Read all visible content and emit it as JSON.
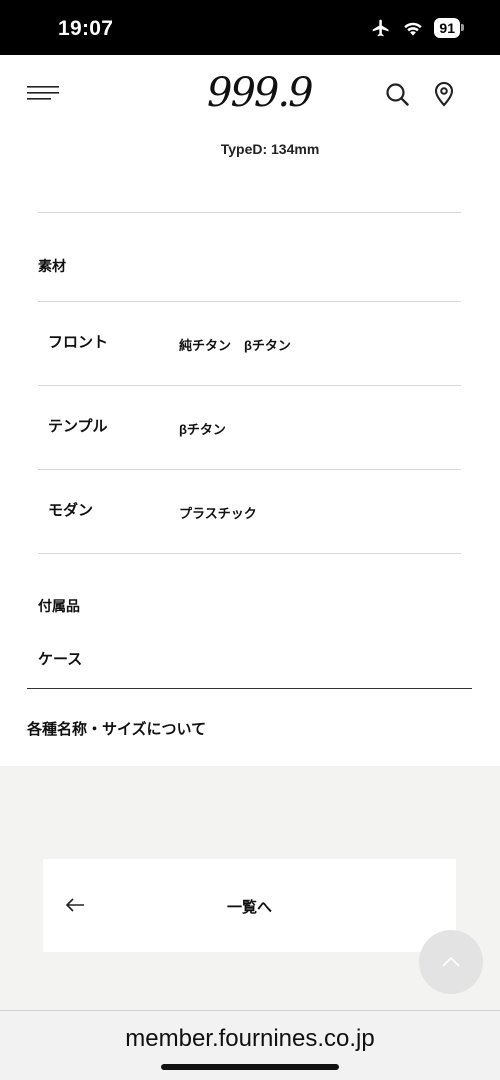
{
  "status_bar": {
    "time": "19:07",
    "battery": "91"
  },
  "header": {
    "logo_text": "999.9"
  },
  "product": {
    "type_text": "TypeD: 134mm"
  },
  "material": {
    "heading": "素材",
    "rows": [
      {
        "label": "フロント",
        "value": "純チタン　βチタン"
      },
      {
        "label": "テンプル",
        "value": "βチタン"
      },
      {
        "label": "モダン",
        "value": "プラスチック"
      }
    ]
  },
  "accessories": {
    "heading": "付属品",
    "value": "ケース"
  },
  "sizes_link": "各種名称・サイズについて",
  "back_button": {
    "label": "一覧へ"
  },
  "browser": {
    "url": "member.fournines.co.jp"
  }
}
